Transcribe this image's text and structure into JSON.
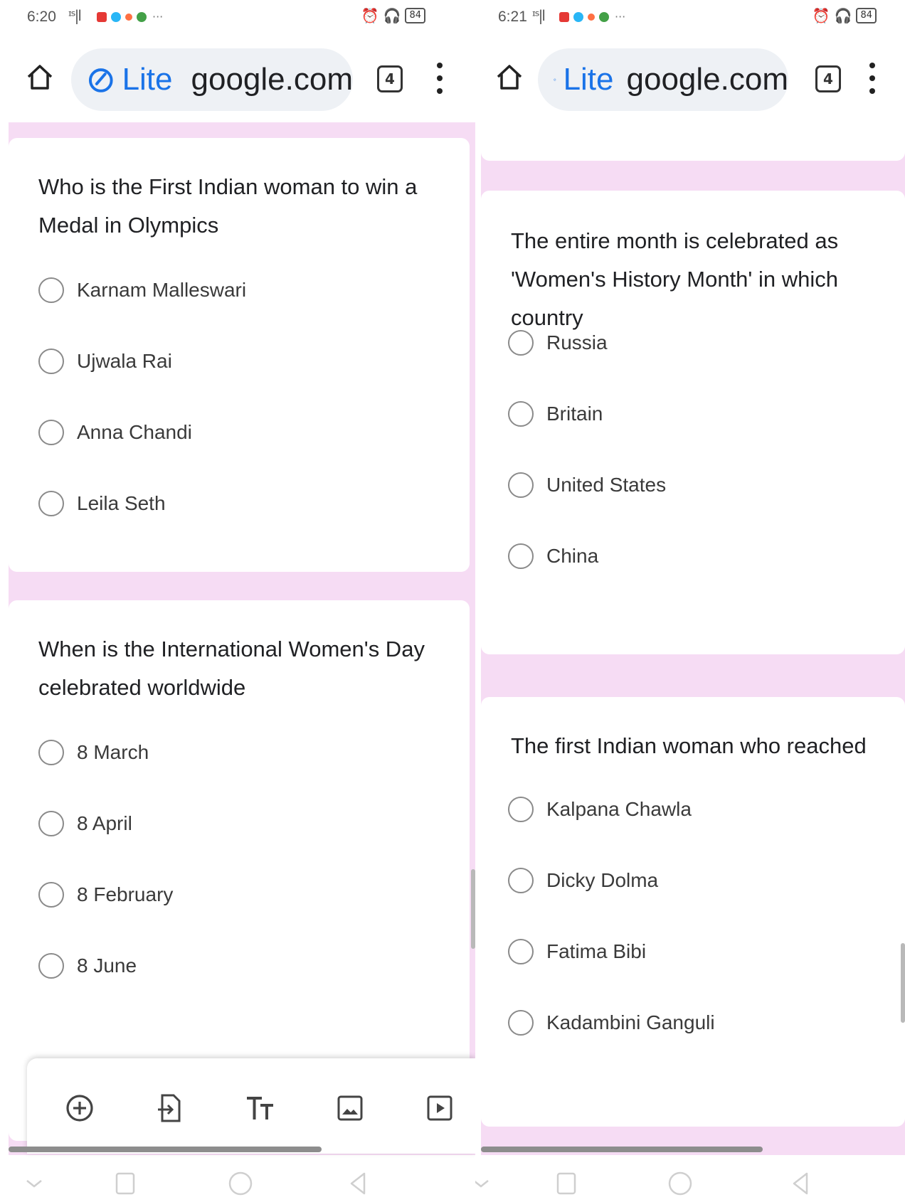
{
  "left": {
    "status": {
      "time": "6:20",
      "signal": "ᶦˢ|l",
      "battery": "84"
    },
    "browser": {
      "lite_label": "Lite",
      "url": "google.com",
      "tab_count": "4"
    },
    "questions": [
      {
        "text": "Who is the First Indian woman to win a Medal in Olympics",
        "options": [
          "Karnam Malleswari",
          "Ujwala Rai",
          "Anna Chandi",
          "Leila Seth"
        ]
      },
      {
        "text": "When is the International Women's Day celebrated worldwide",
        "options": [
          "8 March",
          "8 April",
          "8 February",
          "8 June"
        ]
      }
    ]
  },
  "right": {
    "status": {
      "time": "6:21",
      "signal": "ᶦˢ|l",
      "battery": "84"
    },
    "browser": {
      "lite_label": "Lite",
      "url": "google.com",
      "tab_count": "4"
    },
    "questions": [
      {
        "text": "The entire month is celebrated as 'Women's History Month' in which country",
        "options": [
          "Russia",
          "Britain",
          "United States",
          "China"
        ]
      },
      {
        "text": "The first Indian woman who reached",
        "options": [
          "Kalpana Chawla",
          "Dicky Dolma",
          "Fatima Bibi",
          "Kadambini Ganguli"
        ]
      }
    ]
  },
  "colors": {
    "form_background": "#f6dcf4",
    "accent": "#1a73e8",
    "status_icons": [
      "#e53935",
      "#29b6f6",
      "#ff7043",
      "#43a047"
    ]
  },
  "icons": {
    "form_toolbar": [
      "add-question-icon",
      "import-questions-icon",
      "add-title-icon",
      "add-image-icon",
      "add-video-icon"
    ],
    "nav": [
      "nav-down-icon",
      "recent-apps-icon",
      "home-circle-icon",
      "back-icon"
    ]
  }
}
